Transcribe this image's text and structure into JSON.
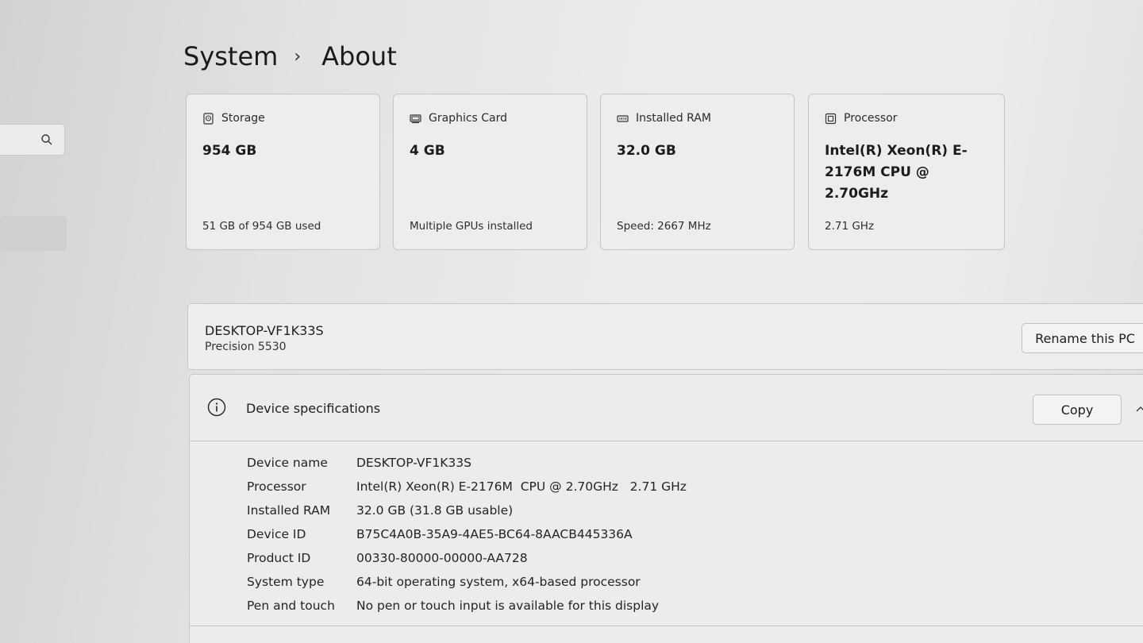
{
  "breadcrumb": {
    "parent": "System",
    "separator": "›",
    "current": "About"
  },
  "cards": [
    {
      "title": "Storage",
      "icon": "storage-icon",
      "value": "954 GB",
      "sub": "51 GB of 954 GB used"
    },
    {
      "title": "Graphics Card",
      "icon": "graphics-card-icon",
      "value": "4 GB",
      "sub": "Multiple GPUs installed"
    },
    {
      "title": "Installed RAM",
      "icon": "ram-icon",
      "value": "32.0 GB",
      "sub": "Speed: 2667 MHz"
    },
    {
      "title": "Processor",
      "icon": "processor-icon",
      "value": "Intel(R) Xeon(R) E-2176M  CPU @ 2.70GHz",
      "sub": "2.71 GHz"
    }
  ],
  "pc": {
    "name": "DESKTOP-VF1K33S",
    "model": "Precision 5530",
    "rename_label": "Rename this PC"
  },
  "specs": {
    "title": "Device specifications",
    "copy_label": "Copy",
    "rows": [
      {
        "label": "Device name",
        "value": "DESKTOP-VF1K33S"
      },
      {
        "label": "Processor",
        "value": "Intel(R) Xeon(R) E-2176M  CPU @ 2.70GHz   2.71 GHz"
      },
      {
        "label": "Installed RAM",
        "value": "32.0 GB (31.8 GB usable)"
      },
      {
        "label": "Device ID",
        "value": "B75C4A0B-35A9-4AE5-BC64-8AACB445336A"
      },
      {
        "label": "Product ID",
        "value": "00330-80000-00000-AA728"
      },
      {
        "label": "System type",
        "value": "64-bit operating system, x64-based processor"
      },
      {
        "label": "Pen and touch",
        "value": "No pen or touch input is available for this display"
      }
    ]
  }
}
